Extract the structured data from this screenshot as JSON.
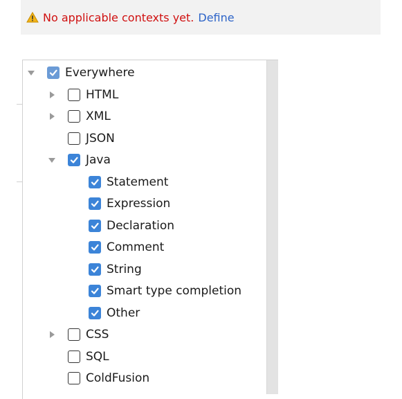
{
  "banner": {
    "message": "No applicable contexts yet.",
    "link": "Define",
    "icon": "warning-icon"
  },
  "tree": {
    "root": {
      "label": "Everywhere",
      "checked": true,
      "expanded": true
    },
    "items": [
      {
        "label": "HTML",
        "checked": false,
        "expandable": true,
        "expanded": false
      },
      {
        "label": "XML",
        "checked": false,
        "expandable": true,
        "expanded": false
      },
      {
        "label": "JSON",
        "checked": false,
        "expandable": false
      },
      {
        "label": "Java",
        "checked": true,
        "expandable": true,
        "expanded": true,
        "children": [
          {
            "label": "Statement",
            "checked": true
          },
          {
            "label": "Expression",
            "checked": true
          },
          {
            "label": "Declaration",
            "checked": true
          },
          {
            "label": "Comment",
            "checked": true
          },
          {
            "label": "String",
            "checked": true
          },
          {
            "label": "Smart type completion",
            "checked": true
          },
          {
            "label": "Other",
            "checked": true
          }
        ]
      },
      {
        "label": "CSS",
        "checked": false,
        "expandable": true,
        "expanded": false
      },
      {
        "label": "SQL",
        "checked": false,
        "expandable": false
      },
      {
        "label": "ColdFusion",
        "checked": false,
        "expandable": false
      }
    ]
  },
  "colors": {
    "checkbox_checked": "#3c84d8",
    "warning_text": "#d01010",
    "link": "#2d64c8"
  }
}
